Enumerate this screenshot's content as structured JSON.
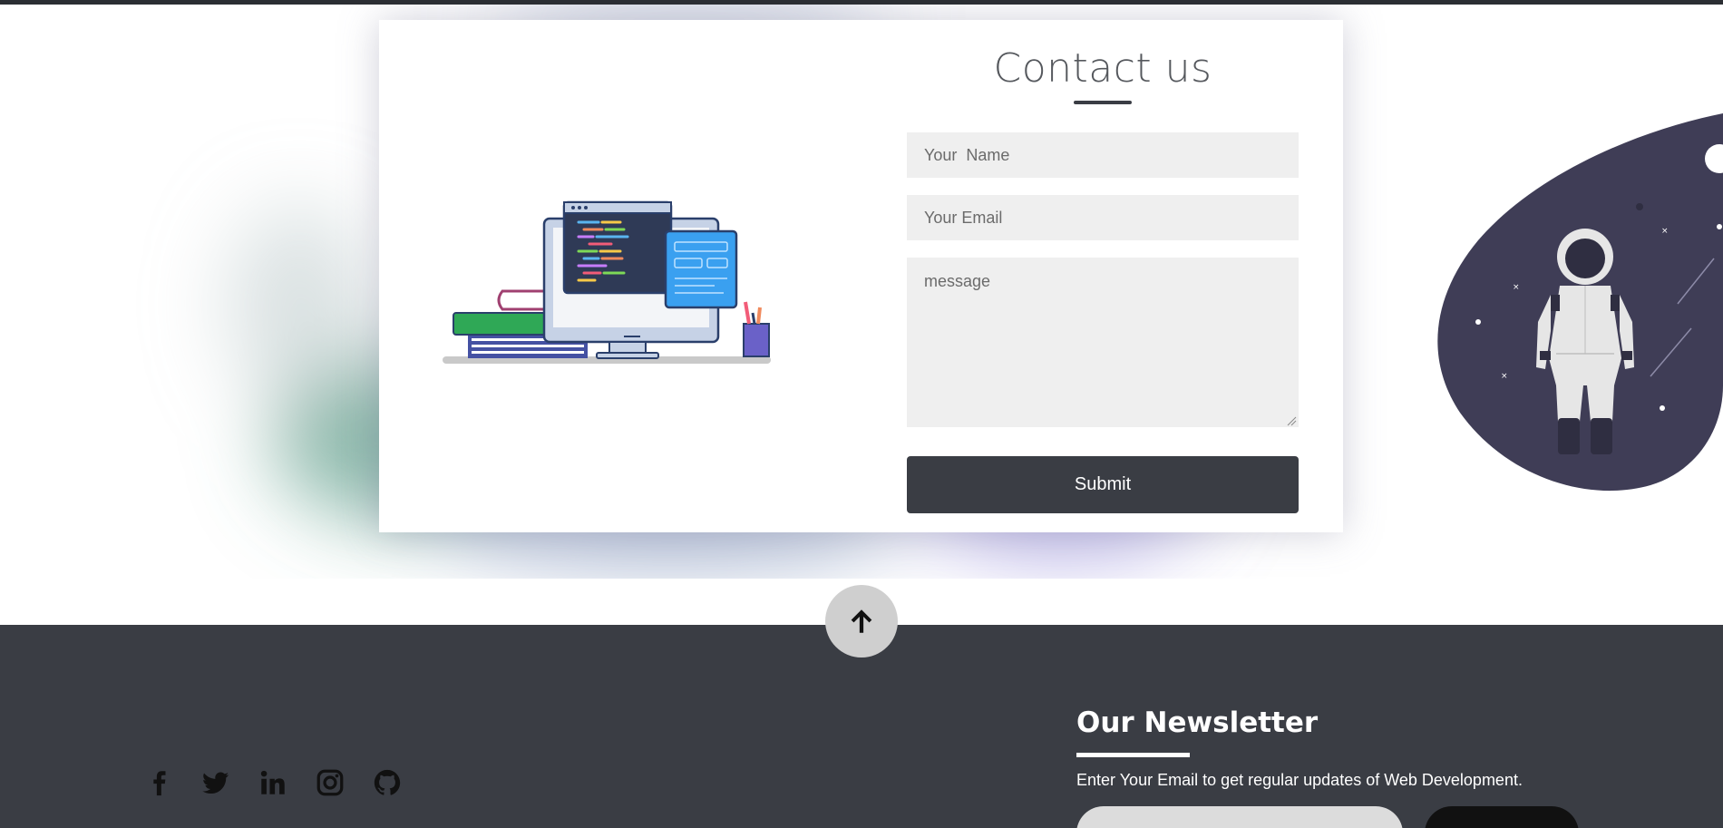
{
  "contact": {
    "title": "Contact us",
    "name_placeholder": "Your  Name",
    "email_placeholder": "Your Email",
    "message_placeholder": "message",
    "submit_label": "Submit"
  },
  "footer": {
    "social_icons": [
      "facebook-icon",
      "twitter-icon",
      "linkedin-icon",
      "instagram-icon",
      "github-icon"
    ],
    "newsletter": {
      "title": "Our Newsletter",
      "description": "Enter Your Email to get regular updates of Web Development."
    }
  },
  "colors": {
    "dark": "#3a3d44",
    "field_bg": "#efefef",
    "scroll_button": "#cfcfcf",
    "astronaut_blob": "#3f3d56"
  }
}
